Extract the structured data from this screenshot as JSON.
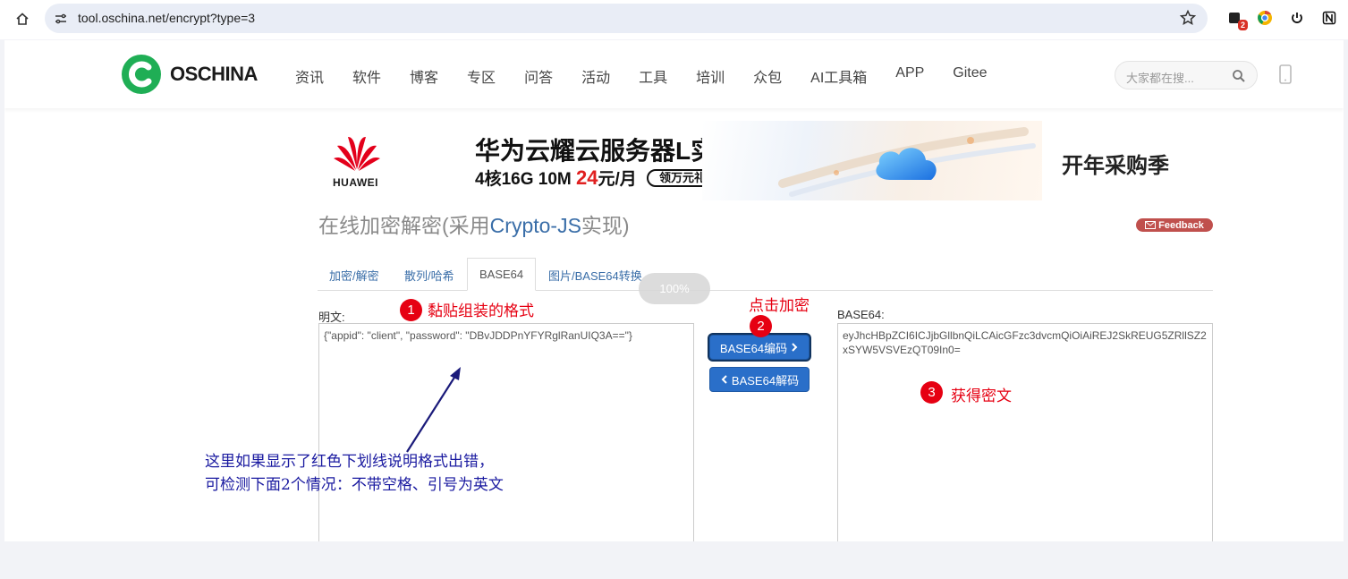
{
  "browser": {
    "url": "tool.oschina.net/encrypt?type=3",
    "extension_badge": "2"
  },
  "header": {
    "logo_text": "OSCHINA",
    "nav": [
      "资讯",
      "软件",
      "博客",
      "专区",
      "问答",
      "活动",
      "工具",
      "培训",
      "众包",
      "AI工具箱",
      "APP",
      "Gitee"
    ],
    "search_placeholder": "大家都在搜..."
  },
  "banner": {
    "brand": "HUAWEI",
    "title": "华为云耀云服务器L实例",
    "spec": "4核16G 10M ",
    "price": "24",
    "price_unit": "元/月",
    "pill": "领万元礼包",
    "right_text": "开年采购季"
  },
  "tool": {
    "title_prefix": "在线加密解密(采用",
    "title_highlight": "Crypto-JS",
    "title_suffix": "实现)",
    "feedback": "Feedback",
    "tabs": [
      "加密/解密",
      "散列/哈希",
      "BASE64",
      "图片/BASE64转换"
    ],
    "progress": "100%",
    "plain_label": "明文:",
    "plain_value": "{\"appid\": \"client\", \"password\": \"DBvJDDPnYFYRglRanUIQ3A==\"}",
    "result_label": "BASE64:",
    "result_value": "eyJhcHBpZCI6ICJjbGllbnQiLCAicGFzc3dvcmQiOiAiREJ2SkREUG5ZRllSZ2xSYW5VSVEzQT09In0=",
    "encode_button": "BASE64编码",
    "decode_button": "BASE64解码"
  },
  "annotations": {
    "step1_num": "1",
    "step1_text": "黏贴组装的格式",
    "step2_text": "点击加密",
    "step2_num": "2",
    "step3_num": "3",
    "step3_text": "获得密文",
    "note_line1": "这里如果显示了红色下划线说明格式出错，",
    "note_line2": "可检测下面2个情况：不带空格、引号为英文"
  }
}
